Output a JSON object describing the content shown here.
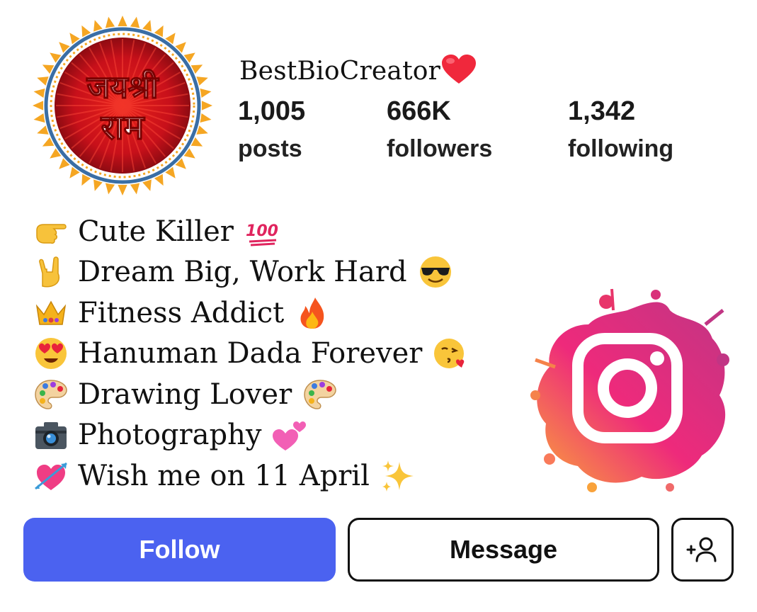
{
  "profile": {
    "username": "BestBioCreator",
    "username_icon": "red-heart-icon",
    "avatar": {
      "text_line1": "जयश्री",
      "text_line2": "राम",
      "icon": "avatar-jai-shri-ram"
    }
  },
  "stats": {
    "posts": {
      "value": "1,005",
      "label": "posts"
    },
    "followers": {
      "value": "666K",
      "label": "followers"
    },
    "following": {
      "value": "1,342",
      "label": "following"
    }
  },
  "bio": [
    {
      "icon": "pointing-hand-icon",
      "text": "Cute Killer",
      "trail_icon": "hundred-points-icon"
    },
    {
      "icon": "rock-hand-icon",
      "text": "Dream Big, Work Hard",
      "trail_icon": "sunglasses-face-icon"
    },
    {
      "icon": "crown-icon",
      "text": "Fitness Addict",
      "trail_icon": "fire-icon"
    },
    {
      "icon": "heart-eyes-face-icon",
      "text": "Hanuman Dada Forever",
      "trail_icon": "kissing-face-icon"
    },
    {
      "icon": "palette-icon",
      "text": "Drawing Lover",
      "trail_icon": "palette-icon"
    },
    {
      "icon": "camera-icon",
      "text": "Photography",
      "trail_icon": "two-hearts-icon"
    },
    {
      "icon": "heart-arrow-icon",
      "text": "Wish me on 11 April",
      "trail_icon": "sparkles-icon"
    }
  ],
  "actions": {
    "follow_label": "Follow",
    "message_label": "Message",
    "add_user_icon": "add-user-icon"
  },
  "colors": {
    "follow_button": "#4b62f0",
    "avatar_red": "#c8101a",
    "avatar_ring": "#3a6ea5",
    "avatar_sun": "#f5a623",
    "instagram_gradient": [
      "#f9a23b",
      "#ee2a7b",
      "#c13584"
    ]
  }
}
